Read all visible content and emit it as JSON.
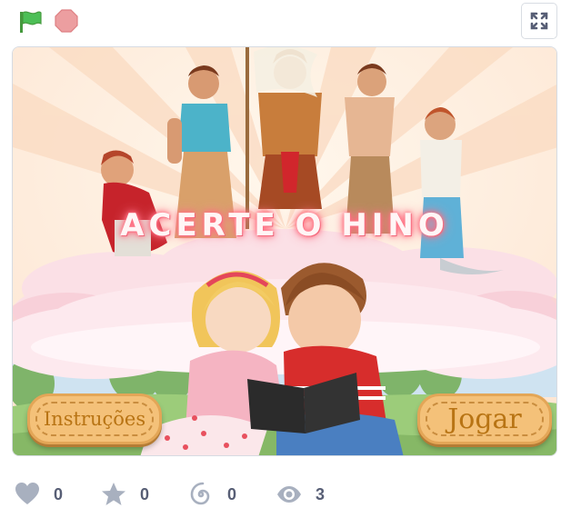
{
  "controls": {
    "green_flag_icon": "green-flag-icon",
    "stop_icon": "stop-sign-icon",
    "fullscreen_icon": "fullscreen-icon"
  },
  "stage": {
    "title": "ACERTE O HINO",
    "buttons": {
      "instructions": "Instruções",
      "play": "Jogar"
    }
  },
  "stats": {
    "loves": "0",
    "favorites": "0",
    "remixes": "0",
    "views": "3"
  },
  "colors": {
    "flag_green": "#4cbf56",
    "stop_red": "#ec9ea0",
    "stats_gray": "#575e75",
    "button_orange": "#f4c179"
  }
}
